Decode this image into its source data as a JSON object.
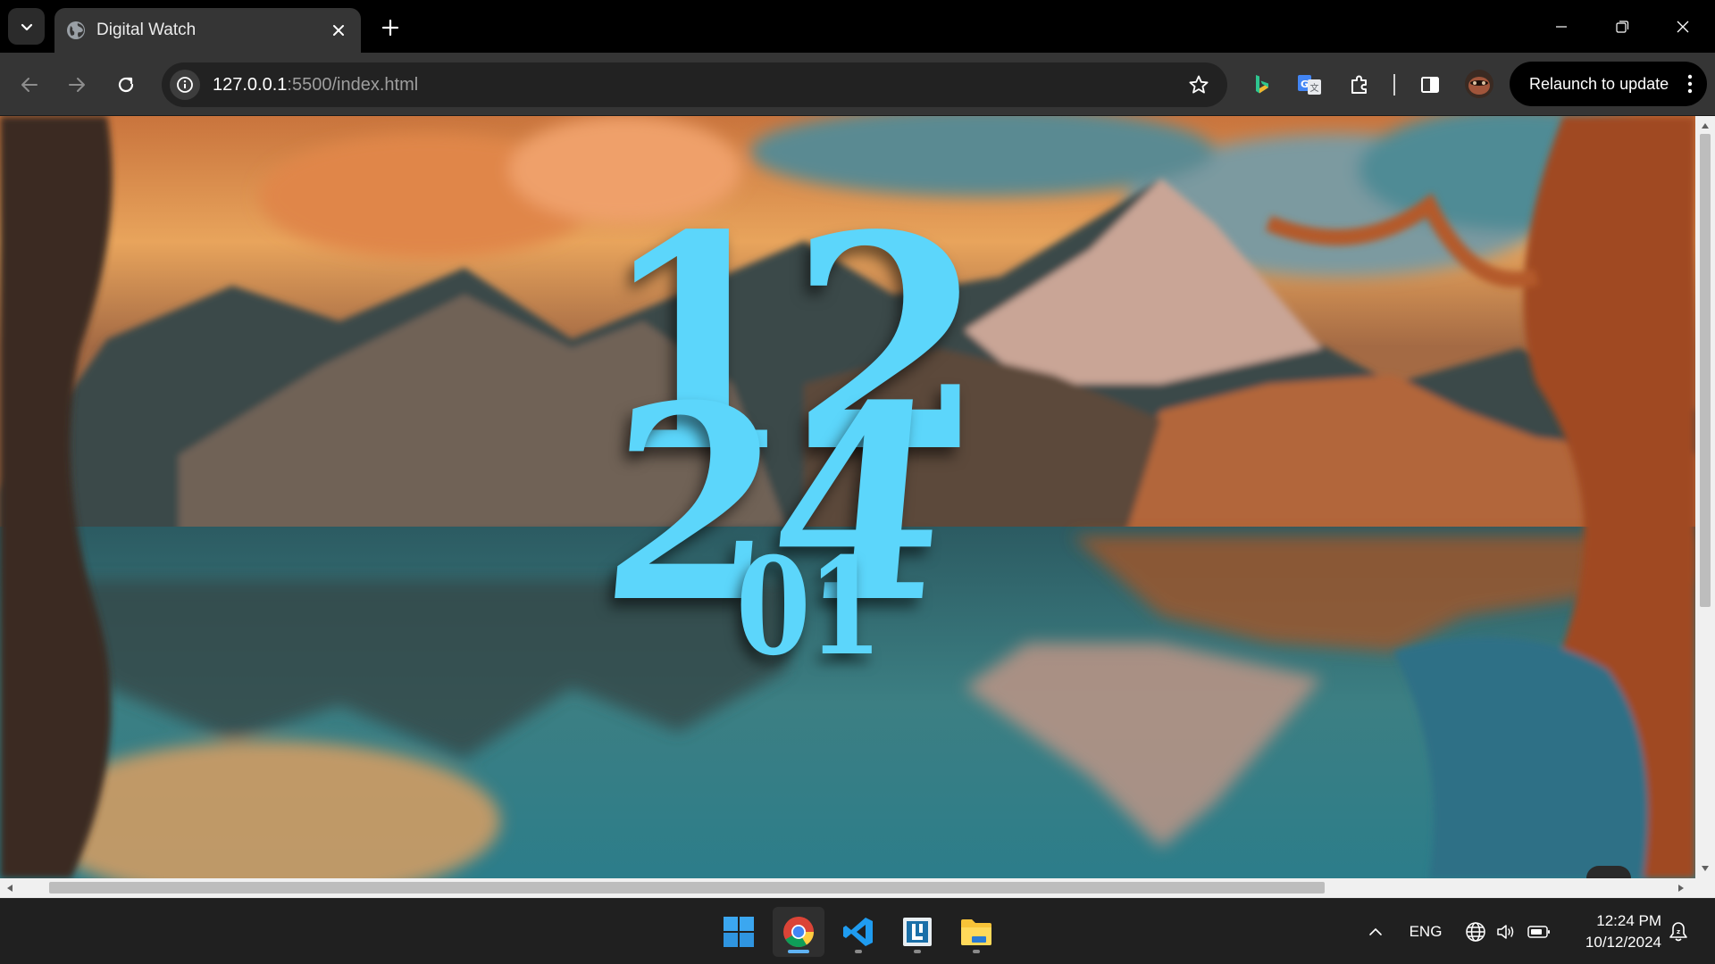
{
  "browser": {
    "tab": {
      "title": "Digital Watch",
      "favicon": "globe-icon"
    },
    "address": {
      "host": "127.0.0.1",
      "rest": ":5500/index.html"
    },
    "relaunch_label": "Relaunch to update",
    "extensions": [
      "bing-icon",
      "google-translate-icon",
      "extensions-puzzle-icon"
    ],
    "accent_color": "#5cd6fb"
  },
  "clock": {
    "hours": "12",
    "minutes": "24",
    "seconds": "01"
  },
  "taskbar": {
    "apps": [
      "windows-start-icon",
      "chrome-icon",
      "vscode-icon",
      "lively-wallpaper-icon",
      "file-explorer-icon"
    ],
    "language": "ENG",
    "time": "12:24 PM",
    "date": "10/12/2024"
  }
}
